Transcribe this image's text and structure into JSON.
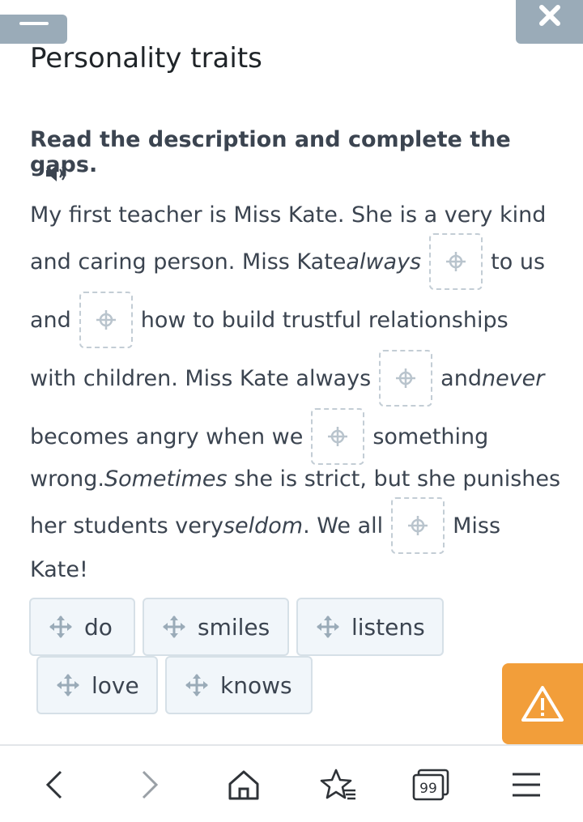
{
  "header": {
    "title": "Personality traits"
  },
  "exercise": {
    "instruction": "Read the description and complete the gaps.",
    "lines": [
      {
        "segments": [
          "My first teacher is Miss Kate. She is a very kind"
        ]
      },
      {
        "segments": [
          "and caring person. Miss Kate ",
          "always",
          "",
          "to us"
        ]
      },
      {
        "segments": [
          "and",
          "",
          "how to build trustful relationships"
        ]
      },
      {
        "segments": [
          "with children. Miss Kate always",
          "",
          "and ",
          "never"
        ]
      },
      {
        "segments": [
          "becomes angry when we",
          "",
          "something"
        ]
      },
      {
        "segments": [
          "wrong. ",
          "Sometimes",
          " she is strict, but she punishes"
        ]
      },
      {
        "segments": [
          "her students very ",
          "seldom",
          ". We all",
          "",
          "Miss"
        ]
      },
      {
        "segments": [
          "Kate!"
        ]
      }
    ],
    "options": [
      "do",
      "smiles",
      "listens",
      "love",
      "knows"
    ]
  },
  "icons": {
    "menu": "menu-icon",
    "close": "close-icon",
    "audio": "speaker-icon",
    "drag": "move-arrows-icon",
    "warning": "warning-triangle-icon",
    "nav": [
      "back-icon",
      "forward-icon",
      "home-icon",
      "favorites-icon",
      "tabs-icon",
      "menu-icon"
    ]
  },
  "bottom_nav": {
    "tabs_count": "99"
  },
  "colors": {
    "top_buttons": "#9aabb8",
    "chip_bg": "#f1f6fa",
    "chip_border": "#d6e0e7",
    "gap_border": "#c3cdd5",
    "warning": "#f29e3a",
    "text": "#3b4450"
  }
}
